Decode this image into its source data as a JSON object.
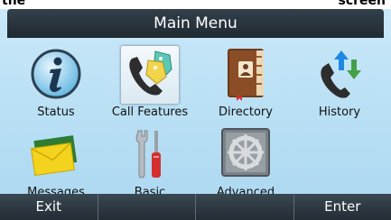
{
  "header_crop": {
    "left_text": "the",
    "right_text": "screen"
  },
  "title": "Main Menu",
  "menu_items": [
    {
      "label": "Status",
      "icon": "info-icon"
    },
    {
      "label": "Call Features",
      "icon": "phone-tags-icon",
      "selected": true
    },
    {
      "label": "Directory",
      "icon": "address-book-icon"
    },
    {
      "label": "History",
      "icon": "call-history-icon"
    },
    {
      "label": "Messages",
      "icon": "envelope-icon"
    },
    {
      "label": "Basic",
      "icon": "tools-icon"
    },
    {
      "label": "Advanced",
      "icon": "settings-gear-icon"
    }
  ],
  "softkeys": [
    "Exit",
    "",
    "",
    "Enter"
  ],
  "colors": {
    "title_bar": "#1f2930",
    "screen_bg": "#c9e8f8",
    "softkey_bg": "#2c3841",
    "selected_bg": "#e8f1f7"
  }
}
